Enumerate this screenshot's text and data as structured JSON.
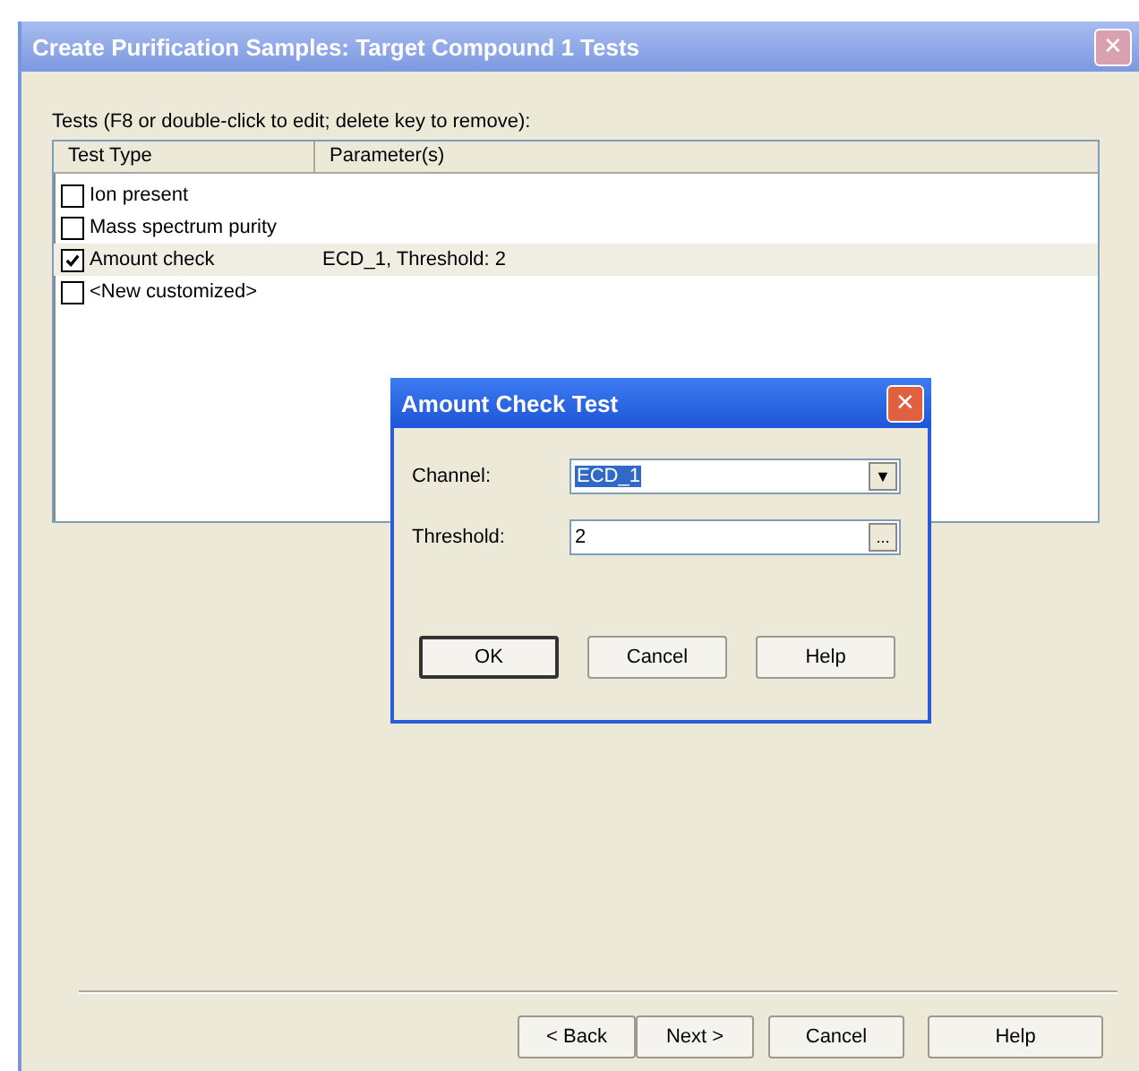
{
  "window": {
    "title": "Create Purification Samples: Target Compound 1 Tests",
    "close": "✕"
  },
  "tests_label": "Tests (F8 or double-click to edit; delete key to remove):",
  "table": {
    "columns": [
      "Test Type",
      "Parameter(s)"
    ],
    "rows": [
      {
        "test_type": "Ion present",
        "parameters": "",
        "checked": false,
        "selected": false
      },
      {
        "test_type": "Mass spectrum purity",
        "parameters": "",
        "checked": false,
        "selected": false
      },
      {
        "test_type": "Amount check",
        "parameters": "ECD_1, Threshold: 2",
        "checked": true,
        "selected": true
      },
      {
        "test_type": "<New customized>",
        "parameters": "",
        "checked": false,
        "selected": false
      }
    ]
  },
  "dialog": {
    "title": "Amount Check Test",
    "close": "✕",
    "fields": [
      {
        "kind": "dropdown",
        "label": "Channel:",
        "value": "ECD_1",
        "button": "▼"
      },
      {
        "kind": "browse",
        "label": "Threshold:",
        "value": "2",
        "button": "..."
      }
    ],
    "buttons": [
      "OK",
      "Cancel",
      "Help"
    ]
  },
  "buttons": [
    "< Back",
    "Next >",
    "Cancel",
    "Help"
  ]
}
